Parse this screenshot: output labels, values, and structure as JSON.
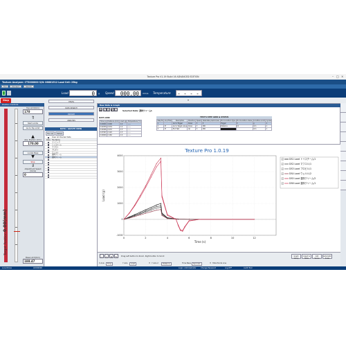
{
  "window": {
    "title": "Texture Pro V1.19 Build 16 ADVANCED EDITION"
  },
  "header": {
    "instrument": "Texture Analyzer: CT3000000  S/N: 06601512 Load Cell: 25kg",
    "toolbar": [
      "Full",
      "Connect",
      "Search"
    ],
    "load_label": "Load",
    "load_value": "0",
    "load_unit": "g",
    "speed_label": "Speed",
    "speed_value": "000.00",
    "speed_unit": "mm/s",
    "temp_label": "Temperature",
    "temp_value": "- - - - -"
  },
  "stop_label": "Stop",
  "position": {
    "header": "Position Controls",
    "top_limit_label": "Top Limit(mm)",
    "top_limit_value": "170",
    "start_label": "Start Limits",
    "goto_label": "Go to Top Limit",
    "position_value": "170.00",
    "position_label": "Abs. Position (mm)",
    "adj_label": "Adjustment Speed (mm/s)",
    "adj_value": "0",
    "locate_label": "Locate Base",
    "stop_label": "Stop",
    "base_limit_label": "Base Limit(mm)",
    "base_limit_value": "188.47",
    "vertical_label": "Target Position",
    "vertical_value": "0.00(mm)"
  },
  "mid": {
    "buttons": [
      "TESTS",
      "DATA SEARCH",
      "EXPORT",
      "ANALYSIS"
    ],
    "active": "EXPORT",
    "panel_title": "DATA / GRAPH VIEW",
    "tabs": [
      "File List",
      "Details"
    ],
    "clear_label": "Clear All Checked Data",
    "col_data": "Data",
    "col_file": "File Name",
    "files": [
      "コンニャク",
      "トイスチーム",
      "マフエル",
      "プロビル",
      "ウェルル",
      "濃厚クリーム",
      "濃厚クリーム"
    ]
  },
  "raw": {
    "title": "Raw Data & Graph",
    "selected_label": "Selected Data:",
    "selected_value": "濃厚クリーム1",
    "grid_caption": "DATA GRID",
    "grid_headers": [
      "Time (s)",
      "Distance (mm)",
      "Load (g)",
      "Temperature (°C)"
    ],
    "grid_rows": [
      [
        "0.00000",
        "0.000",
        "1.2",
        "-----"
      ],
      [
        "0.02059",
        "0.034",
        "1.2",
        "-----"
      ],
      [
        "0.04096",
        "0.070",
        "1.3",
        "-----"
      ],
      [
        "0.07097",
        "0.120",
        "1.3",
        "-----"
      ],
      [
        "0.09000",
        "0.160",
        "1.4",
        "-----"
      ]
    ],
    "steps_caption": "TEST'S STEP GRID & STATUS",
    "steps_headers": [
      "Step Nr",
      "Acq Filter",
      "Description",
      "Direction",
      "Speed",
      "Data Rate pts/mm/sec",
      "End Condition Type",
      "End Condition Value",
      "Condition Limit",
      "Cycles"
    ],
    "steps_rows": [
      [
        "1",
        "",
        "Go to Trigger",
        "Down",
        "3",
        "5",
        "Trigger",
        "5",
        "g",
        "1"
      ],
      [
        "2",
        "M",
        "Go to Target value",
        "Down",
        "3",
        "280",
        "Distance",
        "10",
        "mm",
        "1"
      ],
      [
        "3",
        "M",
        "End Test",
        "Up",
        "3",
        "280",
        "Start",
        "",
        "mm",
        "1"
      ]
    ]
  },
  "chart_data": {
    "type": "line",
    "title": "Texture Pro 1.0.19",
    "xlabel": "Time (s)",
    "ylabel": "Load (g)",
    "xlim": [
      0,
      14
    ],
    "ylim": [
      -1000,
      4000
    ],
    "xticks": [
      0,
      2,
      4,
      6,
      8,
      10,
      12
    ],
    "yticks": [
      -1000,
      0,
      1000,
      2000,
      3000,
      4000
    ],
    "xtick_labels": [
      "0",
      "2",
      "4",
      "6",
      "8",
      "10",
      "12"
    ],
    "ytick_labels": [
      "-1000",
      "0",
      "1000",
      "2000",
      "3000",
      "4000"
    ],
    "grid": true,
    "legend_position": "right",
    "series": [
      {
        "name": "DS1 Load トイスチーム/1",
        "color": "#000000",
        "x": [
          0,
          0.5,
          1,
          1.5,
          2,
          2.5,
          3,
          3.4,
          3.5,
          4,
          5,
          6,
          8,
          10,
          12
        ],
        "y": [
          0,
          150,
          300,
          450,
          600,
          750,
          900,
          1000,
          400,
          100,
          20,
          10,
          0,
          0,
          0
        ]
      },
      {
        "name": "DS2 Load マフエル/1",
        "color": "#333333",
        "x": [
          0,
          0.5,
          1,
          1.5,
          2,
          2.5,
          3,
          3.4,
          3.5,
          4,
          5,
          6,
          8,
          10,
          12
        ],
        "y": [
          0,
          120,
          260,
          380,
          520,
          660,
          800,
          850,
          350,
          80,
          15,
          5,
          0,
          0,
          0
        ]
      },
      {
        "name": "DS3 Load プロビル/1",
        "color": "#555555",
        "x": [
          0,
          0.5,
          1,
          1.5,
          2,
          2.5,
          3,
          3.4,
          3.5,
          4,
          5,
          6,
          8,
          10,
          12
        ],
        "y": [
          0,
          100,
          220,
          340,
          460,
          580,
          700,
          760,
          300,
          60,
          10,
          5,
          0,
          0,
          0
        ]
      },
      {
        "name": "DS4 Load ウェルル/2",
        "color": "#8a3040",
        "x": [
          0,
          0.5,
          1,
          1.5,
          2,
          2.5,
          3,
          3.4,
          3.5,
          4,
          5,
          6,
          8,
          10,
          12
        ],
        "y": [
          0,
          80,
          180,
          280,
          380,
          480,
          580,
          620,
          250,
          50,
          10,
          5,
          0,
          0,
          0
        ]
      },
      {
        "name": "DS5 Load 濃厚クリーム/2",
        "color": "#c0304a",
        "x": [
          0,
          0.5,
          1,
          1.5,
          2,
          2.5,
          3,
          3.4,
          3.5,
          4,
          4.8,
          5,
          5.2,
          5.4,
          5.6,
          6,
          7,
          8,
          10,
          12
        ],
        "y": [
          0,
          400,
          900,
          1500,
          2100,
          2800,
          3500,
          3850,
          1500,
          300,
          0,
          -400,
          -700,
          -750,
          -500,
          -100,
          0,
          0,
          0,
          0
        ]
      },
      {
        "name": "DS6 Load 濃厚クリーム/1",
        "color": "#d03858",
        "x": [
          0,
          0.5,
          1,
          1.5,
          2,
          2.5,
          3,
          3.4,
          3.5,
          4,
          4.8,
          5,
          5.2,
          5.4,
          5.6,
          6,
          7,
          8,
          10,
          12
        ],
        "y": [
          0,
          380,
          850,
          1400,
          2000,
          2650,
          3300,
          3650,
          1400,
          250,
          0,
          -350,
          -650,
          -700,
          -450,
          -80,
          0,
          0,
          0,
          0
        ]
      }
    ]
  },
  "bottom": {
    "hint": "Drag Left button to Zoom, Right button to Scroll",
    "x_axis_label": "X Axis",
    "x_axis_value": "Time",
    "y_axis_label": "Y Axis",
    "y_axis_value": "Load",
    "y2_label": "Y Axis 2",
    "y2_value": "Distance",
    "base_label": "Time Base",
    "base_value": "Seconds",
    "legend_cb_label": "Hide Points Line",
    "buttons": [
      "Graph Setup",
      "Graph & Table",
      "Add Series",
      "Automatic Scale"
    ]
  },
  "status": [
    "Local Drive",
    "AC000000",
    "Login: Administrator",
    "Change Password",
    "Log OFF",
    "Audit Trail"
  ]
}
